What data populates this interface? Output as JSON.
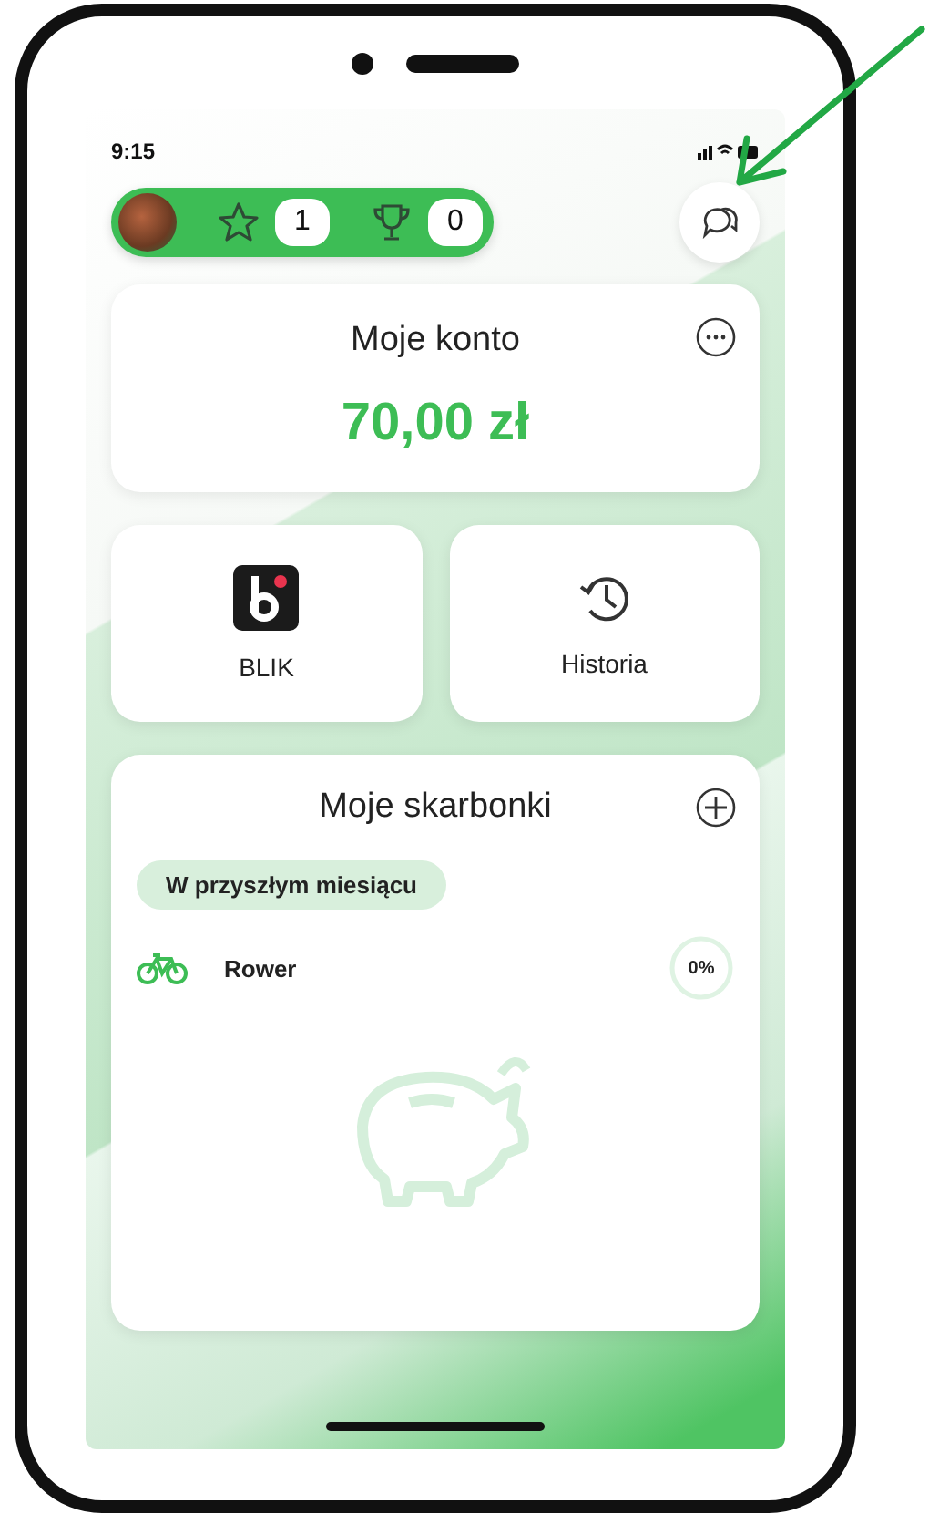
{
  "status_bar": {
    "time": "9:15"
  },
  "header": {
    "stars": "1",
    "trophies": "0"
  },
  "account": {
    "title": "Moje konto",
    "balance": "70,00 zł"
  },
  "tiles": [
    {
      "kind": "blik",
      "label": "BLIK"
    },
    {
      "kind": "history",
      "label": "Historia"
    }
  ],
  "savings": {
    "title": "Moje skarbonki",
    "group": "W przyszłym miesiącu",
    "items": [
      {
        "name": "Rower",
        "percent": "0%",
        "level": 0
      }
    ]
  }
}
